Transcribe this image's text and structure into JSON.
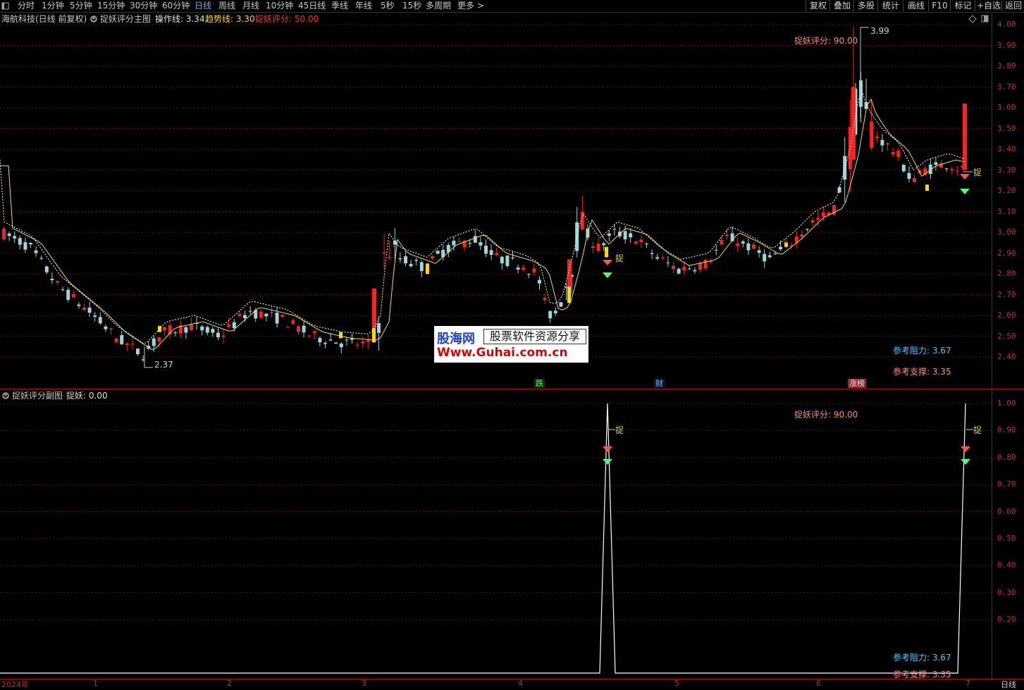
{
  "toolbar": {
    "periods": [
      "分时",
      "1分钟",
      "5分钟",
      "15分钟",
      "30分钟",
      "60分钟",
      "日线",
      "周线",
      "月线",
      "10分钟",
      "45日线",
      "季线",
      "年线",
      "5秒",
      "15秒",
      "多周期",
      "更多 >"
    ],
    "active_period": "日线",
    "right_buttons": [
      "复权",
      "叠加",
      "多股",
      "统计",
      "画线",
      "F10",
      "标记",
      "+自选",
      "返回"
    ]
  },
  "main_panel": {
    "stock_title": "海航科技(日线 前复权)",
    "indicator_name": "捉妖评分主图",
    "op_line_label": "操作线: 3.34",
    "trend_line_label": "趋势线: 3.30",
    "score_label": "捉妖评分: 50.00",
    "score_annotation": "捉妖评分: 90.00",
    "high_label": "3.99",
    "low_label": "2.37",
    "resistance": "参考阻力: 3.67",
    "support": "参考支撑: 3.35",
    "signal_text": "捉",
    "price_ticks": [
      "4.00",
      "3.90",
      "3.80",
      "3.70",
      "3.60",
      "3.50",
      "3.40",
      "3.30",
      "3.20",
      "3.10",
      "3.00",
      "2.90",
      "2.80",
      "2.70",
      "2.60",
      "2.50",
      "2.40"
    ],
    "event_tags": [
      "跌",
      "财",
      "涨榜"
    ]
  },
  "sub_panel": {
    "indicator_name": "捉妖评分副图",
    "value_label": "捉妖: 0.00",
    "score_annotation": "捉妖评分: 90.00",
    "resistance": "参考阻力: 3.67",
    "support": "参考支撑: 3.35",
    "signal_text": "捉",
    "ticks": [
      "1.00",
      "0.90",
      "0.80",
      "0.70",
      "0.60",
      "0.50",
      "0.40",
      "0.30",
      "0.20"
    ]
  },
  "time_axis": {
    "labels": [
      "2024年",
      "1",
      "2",
      "3",
      "4",
      "5",
      "6",
      "7"
    ],
    "period_button": "日线"
  },
  "watermark": {
    "brand": "股海网",
    "slogan": "股票软件资源分享",
    "url": "Www.Guhai.com.cn"
  },
  "colors": {
    "up": "#ff2020",
    "down": "#9fd4d8",
    "signal": "#ffd800",
    "trend_line": "#e6e640",
    "grid": "#7a0000",
    "axis_text": "#c03030",
    "resistance_color": "#4ec8ff",
    "support_color": "#ff8c8c"
  },
  "icons": [
    "window-icon",
    "collapse-icon",
    "settings-icon",
    "diamond-icon",
    "restore-icon"
  ]
}
